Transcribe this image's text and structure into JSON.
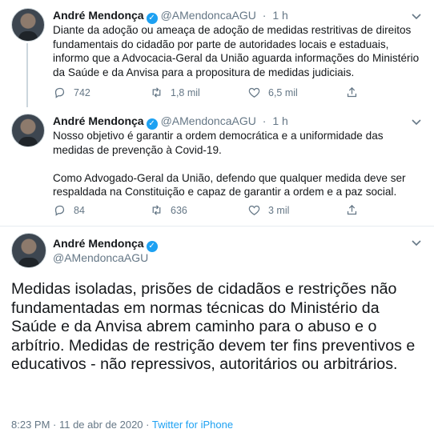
{
  "tweets": [
    {
      "name": "André Mendonça",
      "handle": "@AMendoncaAGU",
      "sep": "·",
      "time": "1 h",
      "text": "Diante da adoção ou ameaça de adoção de medidas restritivas de direitos fundamentais do cidadão por parte de autoridades locais e estaduais, informo que a Advocacia-Geral da União aguarda informações do Ministério da Saúde e da Anvisa para a propositura de medidas judiciais.",
      "replies": "742",
      "retweets": "1,8 mil",
      "likes": "6,5 mil"
    },
    {
      "name": "André Mendonça",
      "handle": "@AMendoncaAGU",
      "sep": "·",
      "time": "1 h",
      "text": "Nosso objetivo é garantir a ordem democrática e a uniformidade das medidas de prevenção à Covid-19.\n\nComo Advogado-Geral da União, defendo que qualquer medida deve ser respaldada na Constituição e capaz de garantir a ordem e a paz social.",
      "replies": "84",
      "retweets": "636",
      "likes": "3 mil"
    }
  ],
  "main_tweet": {
    "name": "André Mendonça",
    "handle": "@AMendoncaAGU",
    "text": "Medidas isoladas, prisões de cidadãos e restrições não fundamentadas em normas técnicas do Ministério da Saúde e da Anvisa abrem caminho para o abuso e o arbítrio. Medidas de restrição devem ter fins preventivos e educativos - não repressivos, autoritários ou arbitrários.",
    "timestamp": "8:23 PM · 11 de abr de 2020",
    "meta_sep": "·",
    "client": "Twitter for iPhone"
  },
  "icons": {
    "verified": "verified-badge-icon",
    "more": "chevron-down-icon",
    "reply": "reply-icon",
    "retweet": "retweet-icon",
    "like": "heart-icon",
    "share": "share-icon"
  },
  "colors": {
    "accent": "#1da1f2",
    "secondary_text": "#657786",
    "divider": "#e6ecf0"
  }
}
